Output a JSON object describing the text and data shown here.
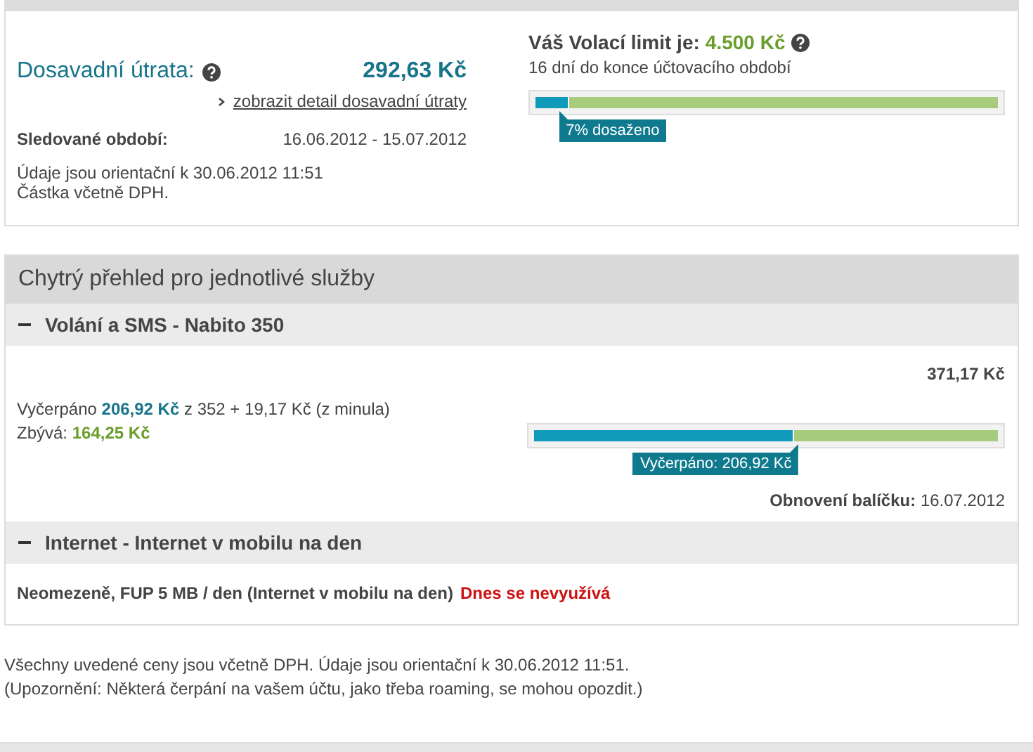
{
  "spending": {
    "title": "Dosavadní útrata:",
    "amount": "292,63 Kč",
    "detail_link": "zobrazit detail dosavadní útraty",
    "period_label": "Sledované období:",
    "period": "16.06.2012 - 15.07.2012",
    "notes": [
      "Údaje jsou orientační k 30.06.2012 11:51",
      "Částka včetně DPH."
    ]
  },
  "limit": {
    "label": "Váš Volací limit je:",
    "amount": "4.500 Kč",
    "days_left": "16 dní do konce účtovacího období",
    "level": 0.07,
    "tooltip": "7% dosaženo"
  },
  "services": {
    "title": "Chytrý přehled pro jednotlivé služby",
    "items": [
      {
        "kind": "package",
        "title": "Volání a SMS - Nabito 350",
        "expanded": true,
        "total": "371,17 Kč",
        "used": "Vyčerpáno **206,92 Kč** z 352 + 19,17 Kč (z minula)",
        "remaining": "Zbývá: **164,25 Kč**",
        "level": 0.557,
        "tooltip": "Vyčerpáno: 206,92 Kč",
        "renewal_label": "Obnovení balíčku:",
        "renewal": "16.07.2012"
      },
      {
        "kind": "unlimited",
        "title": "Internet - Internet v mobilu na den",
        "expanded": true,
        "description": "Neomezeně, FUP 5 MB / den (Internet v mobilu na den)",
        "status": "Dnes se nevyužívá"
      }
    ]
  },
  "footer": [
    "Všechny uvedené ceny jsou včetně DPH. Údaje jsou orientační k 30.06.2012 11:51.",
    "(Upozornění: Některá čerpání na vašem účtu, jako třeba roaming, se mohou opozdit.)"
  ]
}
